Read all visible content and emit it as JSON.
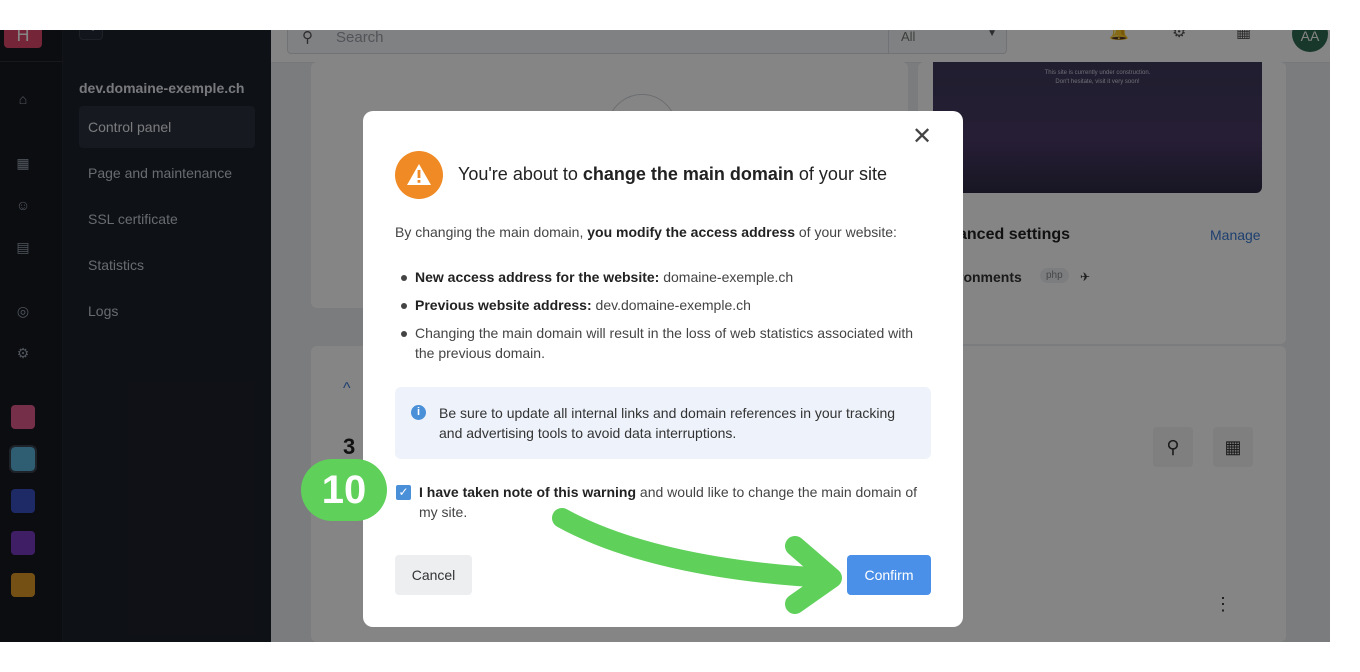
{
  "rail": {
    "brand_letter": "H",
    "icons": [
      "home-icon",
      "calculator-icon",
      "users-icon",
      "building-icon",
      "headset-icon",
      "robot-icon"
    ],
    "apps": [
      "kmeet-app",
      "kdrive-app",
      "app-blue",
      "app-purple",
      "app-orange"
    ]
  },
  "sidebar": {
    "collapse": "<",
    "site_name": "dev.domaine-exemple.ch",
    "items": [
      {
        "label": "Control panel",
        "active": true
      },
      {
        "label": "Page and maintenance"
      },
      {
        "label": "SSL certificate"
      },
      {
        "label": "Statistics"
      },
      {
        "label": "Logs"
      }
    ]
  },
  "header": {
    "search_placeholder": "Search",
    "filter_value": "All",
    "avatar_initials": "AA"
  },
  "background": {
    "preview_text1": "This site is currently under construction.",
    "preview_text2": "Don't hesitate, visit it very soon!",
    "advanced_settings": "anced settings",
    "manage": "Manage",
    "environments": "ronments",
    "php": "php",
    "count": "3"
  },
  "modal": {
    "title_prefix": "You're about to ",
    "title_bold": "change the main domain",
    "title_suffix": " of your site",
    "intro_prefix": "By changing the main domain, ",
    "intro_bold": "you modify the access address",
    "intro_suffix": " of your website:",
    "bullets": [
      {
        "label": "New access address for the website:",
        "value": " domaine-exemple.ch"
      },
      {
        "label": "Previous website address:",
        "value": " dev.domaine-exemple.ch"
      },
      {
        "label": "",
        "value": "Changing the main domain will result in the loss of web statistics associated with the previous domain."
      }
    ],
    "info": "Be sure to update all internal links and domain references in your tracking and advertising tools to avoid data interruptions.",
    "checkbox_checked": true,
    "checkbox_bold": "I have taken note of this warning",
    "checkbox_rest": " and would like to change the main domain of my site.",
    "cancel": "Cancel",
    "confirm": "Confirm"
  },
  "annotation": {
    "step": "10",
    "color": "#5fd05a"
  }
}
